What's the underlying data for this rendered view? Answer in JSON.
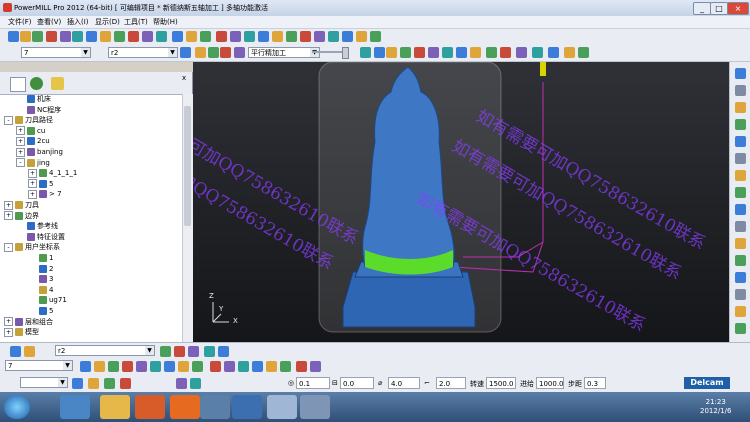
{
  "window": {
    "title": "PowerMILL Pro 2012 (64-bit)   [ 可编辑项目 * 新德纳斯五轴加工 ]   多轴功能激活",
    "buttons": [
      "_",
      "□",
      "×"
    ]
  },
  "menu": [
    "文件(F)",
    "查看(V)",
    "插入(I)",
    "显示(D)",
    "工具(T)",
    "帮助(H)"
  ],
  "toolbar": {
    "tool_combo": "7",
    "workplane_combo": "r2",
    "strategy_combo": "平行精加工"
  },
  "explorer": {
    "tree": [
      {
        "label": "机床",
        "level": 1,
        "expander": ""
      },
      {
        "label": "NC程序",
        "level": 1,
        "expander": ""
      },
      {
        "label": "刀具路径",
        "level": 0,
        "expander": "-"
      },
      {
        "label": "cu",
        "level": 1,
        "expander": "+"
      },
      {
        "label": "2cu",
        "level": 1,
        "expander": "+"
      },
      {
        "label": "banjing",
        "level": 1,
        "expander": "+"
      },
      {
        "label": "jing",
        "level": 1,
        "expander": "-"
      },
      {
        "label": "4_1_1_1",
        "level": 2,
        "expander": "+"
      },
      {
        "label": "5",
        "level": 2,
        "expander": "+"
      },
      {
        "label": "> 7",
        "level": 2,
        "expander": "+"
      },
      {
        "label": "刀具",
        "level": 0,
        "expander": "+"
      },
      {
        "label": "边界",
        "level": 0,
        "expander": "+"
      },
      {
        "label": "参考线",
        "level": 1,
        "expander": ""
      },
      {
        "label": "特征设置",
        "level": 1,
        "expander": ""
      },
      {
        "label": "用户坐标系",
        "level": 0,
        "expander": "-"
      },
      {
        "label": "1",
        "level": 2,
        "expander": ""
      },
      {
        "label": "2",
        "level": 2,
        "expander": ""
      },
      {
        "label": "3",
        "level": 2,
        "expander": ""
      },
      {
        "label": "4",
        "level": 2,
        "expander": ""
      },
      {
        "label": "ug71",
        "level": 2,
        "expander": ""
      },
      {
        "label": "5",
        "level": 2,
        "expander": ""
      },
      {
        "label": "层和组合",
        "level": 0,
        "expander": "+"
      },
      {
        "label": "模型",
        "level": 0,
        "expander": "+"
      }
    ]
  },
  "viewport": {
    "watermark": "如有需要可加QQ758632610联系",
    "axes": {
      "z": "Z",
      "y": "Y",
      "x": "X"
    }
  },
  "bottom": {
    "tool_combo": "r2",
    "tool_num": "7",
    "tolerance": "0.1",
    "stock_thickness": "0.0",
    "step": "4.0",
    "depth": "2.0",
    "spindle_label": "转速",
    "spindle_value": "1500.0",
    "feed_label": "进给",
    "feed_value": "1000.0",
    "stepover_label": "步距",
    "stepover_value": "0.3",
    "brand": "Delcam"
  },
  "taskbar": {
    "time": "21:23",
    "date": "2012/1/6"
  },
  "colors": {
    "model": "#3e78c4",
    "highlight": "#5bdc2a",
    "watermark": "#8c3cff",
    "toolpath": "#c02fb4"
  }
}
